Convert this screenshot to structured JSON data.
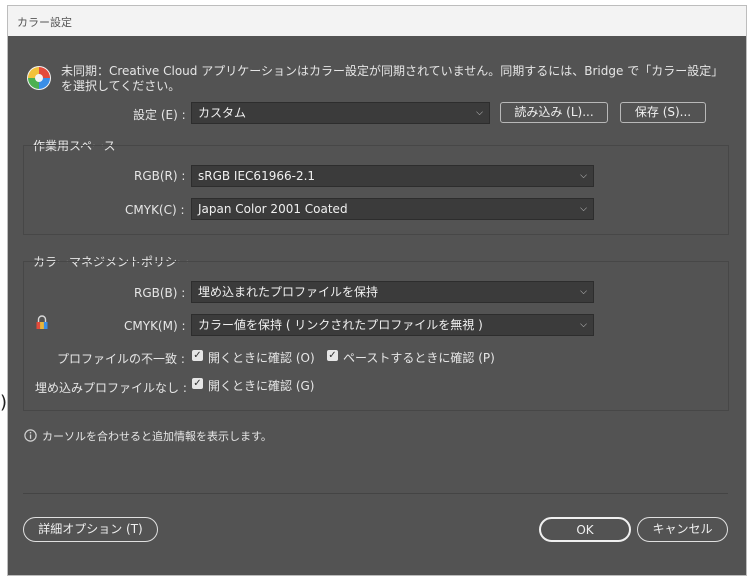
{
  "stray_char": ")",
  "window": {
    "title": "カラー設定"
  },
  "warning": {
    "icon": "color-wheel-icon",
    "line1": "未同期：Creative Cloud アプリケーションはカラー設定が同期されていません。同期するには、Bridge で「カラー設定」",
    "line2": "を選択してください。"
  },
  "settings": {
    "label": "設定 (E) :",
    "value": "カスタム",
    "load_button": "読み込み (L)...",
    "save_button": "保存 (S)..."
  },
  "working_spaces": {
    "title": "作業用スペース",
    "rgb_label": "RGB(R) :",
    "rgb_value": "sRGB IEC61966-2.1",
    "cmyk_label": "CMYK(C) :",
    "cmyk_value": "Japan Color 2001 Coated"
  },
  "policies": {
    "title": "カラーマネジメントポリシー",
    "rgb_label": "RGB(B) :",
    "rgb_value": "埋め込まれたプロファイルを保持",
    "cmyk_label": "CMYK(M) :",
    "cmyk_value": "カラー値を保持 ( リンクされたプロファイルを無視 )",
    "mismatch_label": "プロファイルの不一致 :",
    "ask_open": "開くときに確認 (O)",
    "ask_paste": "ペーストするときに確認 (P)",
    "missing_label": "埋め込みプロファイルなし :",
    "missing_ask_open": "開くときに確認 (G)"
  },
  "info": {
    "text": "カーソルを合わせると追加情報を表示します。"
  },
  "footer": {
    "advanced_button": "詳細オプション (T)",
    "ok_button": "OK",
    "cancel_button": "キャンセル"
  },
  "colors": {
    "dialog_bg": "#535353",
    "field_bg": "#3b3b3b",
    "text": "#e6e6e6"
  }
}
